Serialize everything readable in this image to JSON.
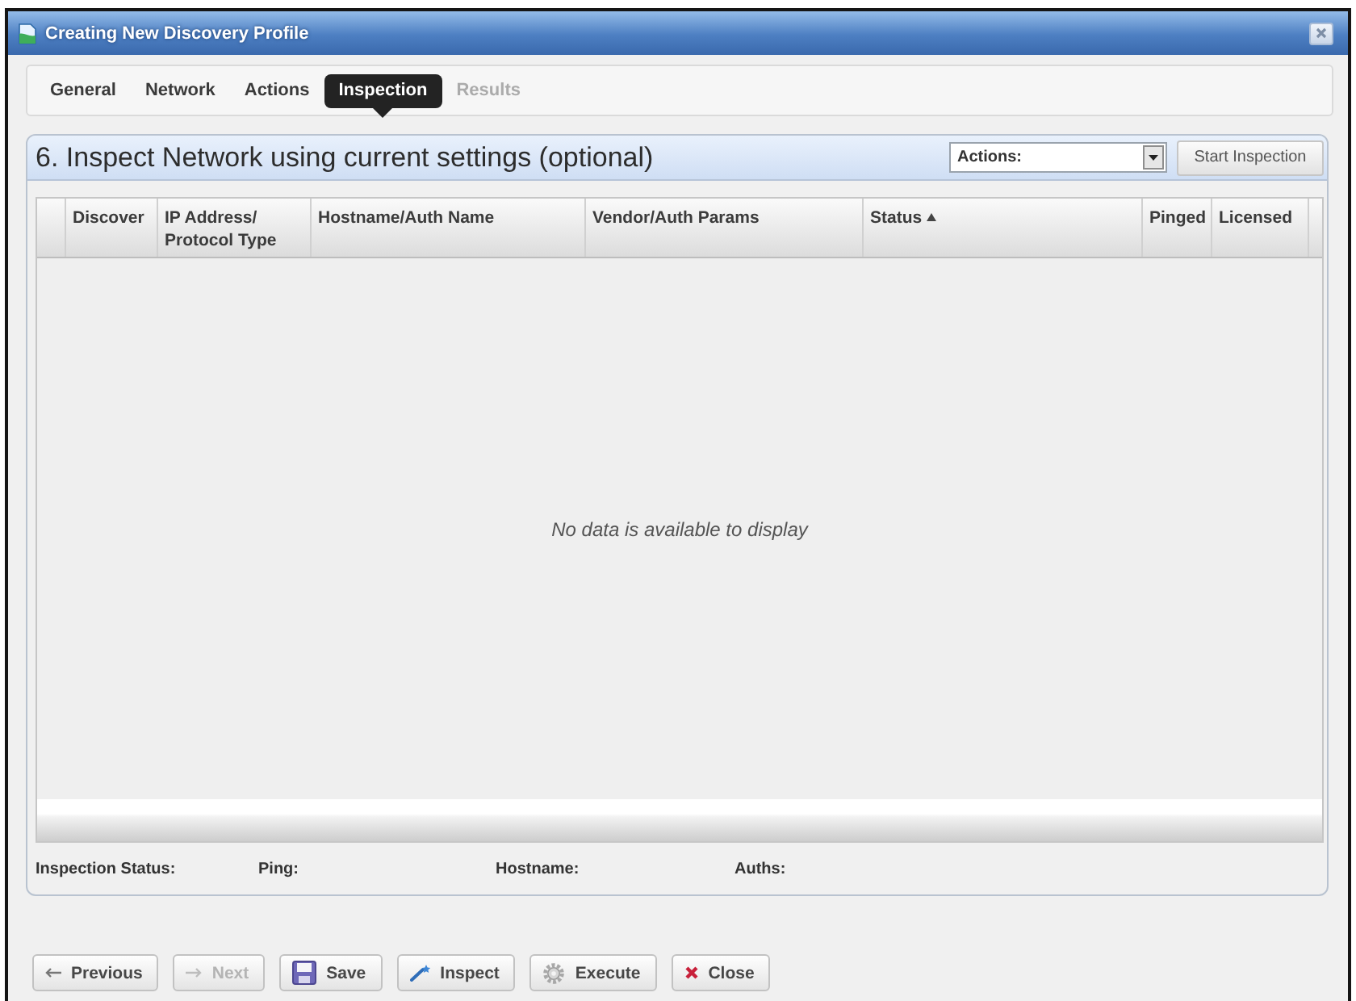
{
  "window": {
    "title": "Creating New Discovery Profile"
  },
  "tabs": [
    {
      "label": "General",
      "selected": false,
      "disabled": false
    },
    {
      "label": "Network",
      "selected": false,
      "disabled": false
    },
    {
      "label": "Actions",
      "selected": false,
      "disabled": false
    },
    {
      "label": "Inspection",
      "selected": true,
      "disabled": false
    },
    {
      "label": "Results",
      "selected": false,
      "disabled": true
    }
  ],
  "section": {
    "title": "6. Inspect Network using current settings (optional)",
    "actions_select": {
      "value": "Actions:"
    },
    "start_button": {
      "label": "Start Inspection"
    }
  },
  "table": {
    "columns": [
      {
        "label": "Discover",
        "sorted": false
      },
      {
        "label": "IP Address/ Protocol Type",
        "sorted": false
      },
      {
        "label": "Hostname/Auth Name",
        "sorted": false
      },
      {
        "label": "Vendor/Auth Params",
        "sorted": false
      },
      {
        "label": "Status",
        "sorted": true
      },
      {
        "label": "Pinged",
        "sorted": false
      },
      {
        "label": "Licensed",
        "sorted": false
      }
    ],
    "empty_message": "No data is available to display"
  },
  "status_bar": [
    {
      "label": "Inspection Status:"
    },
    {
      "label": "Ping:"
    },
    {
      "label": "Hostname:"
    },
    {
      "label": "Auths:"
    }
  ],
  "buttons": [
    {
      "label": "Previous",
      "kind": "previous",
      "disabled": false
    },
    {
      "label": "Next",
      "kind": "next",
      "disabled": true
    },
    {
      "label": "Save",
      "kind": "save",
      "disabled": false
    },
    {
      "label": "Inspect",
      "kind": "inspect",
      "disabled": false
    },
    {
      "label": "Execute",
      "kind": "execute",
      "disabled": false
    },
    {
      "label": "Close",
      "kind": "close",
      "disabled": false
    }
  ]
}
